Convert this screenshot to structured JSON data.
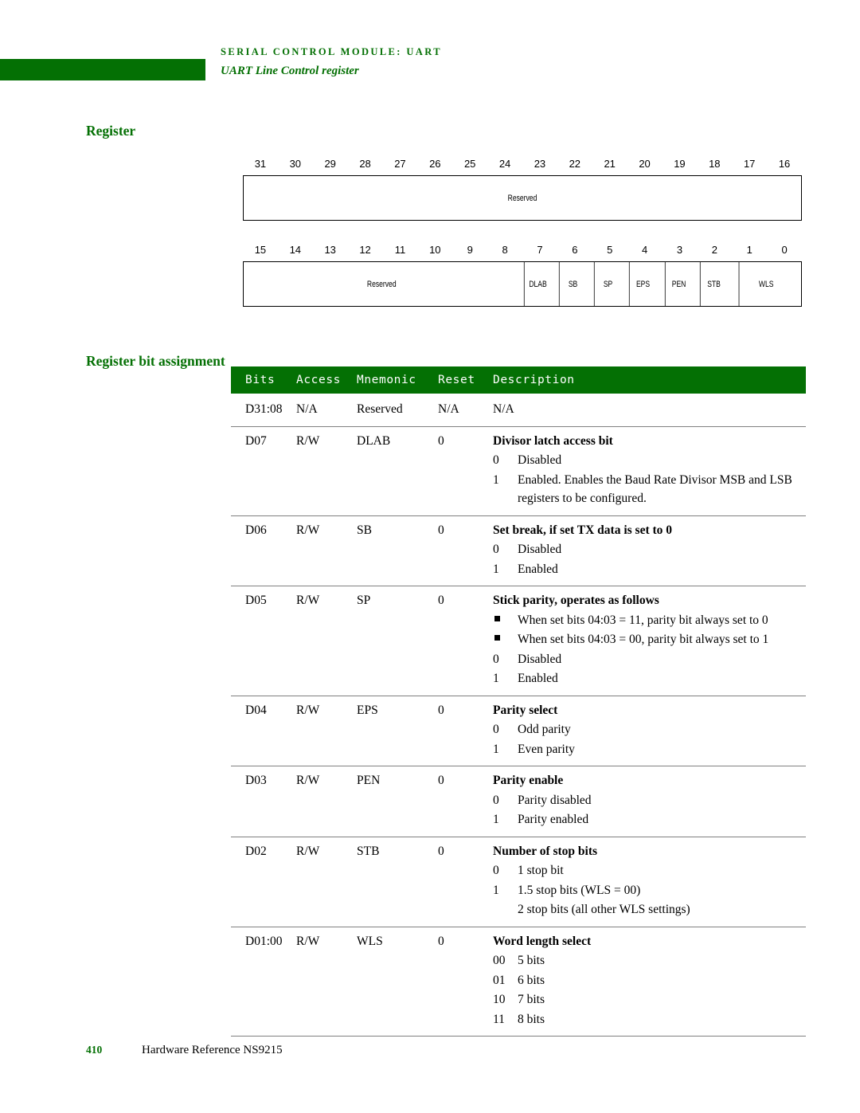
{
  "header": {
    "title": "SERIAL CONTROL MODULE: UART",
    "subtitle": "UART Line Control register",
    "bar_color": "#047004"
  },
  "margin_headings": {
    "register": "Register",
    "bit_assignment": "Register bit assignment"
  },
  "register_diagram": {
    "high_row": {
      "bit_numbers": [
        "31",
        "30",
        "29",
        "28",
        "27",
        "26",
        "25",
        "24",
        "23",
        "22",
        "21",
        "20",
        "19",
        "18",
        "17",
        "16"
      ],
      "fields": [
        {
          "label": "Reserved",
          "span": 16
        }
      ]
    },
    "low_row": {
      "bit_numbers": [
        "15",
        "14",
        "13",
        "12",
        "11",
        "10",
        "9",
        "8",
        "7",
        "6",
        "5",
        "4",
        "3",
        "2",
        "1",
        "0"
      ],
      "fields": [
        {
          "label": "Reserved",
          "span": 8
        },
        {
          "label": "DLAB",
          "span": 1
        },
        {
          "label": "SB",
          "span": 1
        },
        {
          "label": "SP",
          "span": 1
        },
        {
          "label": "EPS",
          "span": 1
        },
        {
          "label": "PEN",
          "span": 1
        },
        {
          "label": "STB",
          "span": 1
        },
        {
          "label": "WLS",
          "span": 2
        }
      ]
    }
  },
  "bit_table": {
    "columns": [
      "Bits",
      "Access",
      "Mnemonic",
      "Reset",
      "Description"
    ],
    "rows": [
      {
        "bits": "D31:08",
        "access": "N/A",
        "mnemonic": "Reserved",
        "reset": "N/A",
        "title": "N/A",
        "title_bold": false,
        "values": []
      },
      {
        "bits": "D07",
        "access": "R/W",
        "mnemonic": "DLAB",
        "reset": "0",
        "title": "Divisor latch access bit",
        "title_bold": true,
        "values": [
          {
            "key": "0",
            "text": "Disabled"
          },
          {
            "key": "1",
            "text": "Enabled. Enables the Baud Rate Divisor MSB and LSB registers to be configured."
          }
        ]
      },
      {
        "bits": "D06",
        "access": "R/W",
        "mnemonic": "SB",
        "reset": "0",
        "title": "Set break, if set TX data is set to 0",
        "title_bold": true,
        "values": [
          {
            "key": "0",
            "text": "Disabled"
          },
          {
            "key": "1",
            "text": "Enabled"
          }
        ]
      },
      {
        "bits": "D05",
        "access": "R/W",
        "mnemonic": "SP",
        "reset": "0",
        "title": "Stick parity, operates as follows",
        "title_bold": true,
        "values": [
          {
            "key": "bullet",
            "text": "When set bits 04:03 = 11, parity bit always set to 0"
          },
          {
            "key": "bullet",
            "text": "When set bits 04:03 = 00, parity bit always set to 1"
          },
          {
            "key": "0",
            "text": "Disabled"
          },
          {
            "key": "1",
            "text": "Enabled"
          }
        ]
      },
      {
        "bits": "D04",
        "access": "R/W",
        "mnemonic": "EPS",
        "reset": "0",
        "title": "Parity select",
        "title_bold": true,
        "values": [
          {
            "key": "0",
            "text": "Odd parity"
          },
          {
            "key": "1",
            "text": "Even parity"
          }
        ]
      },
      {
        "bits": "D03",
        "access": "R/W",
        "mnemonic": "PEN",
        "reset": "0",
        "title": "Parity enable",
        "title_bold": true,
        "values": [
          {
            "key": "0",
            "text": "Parity disabled"
          },
          {
            "key": "1",
            "text": "Parity enabled"
          }
        ]
      },
      {
        "bits": "D02",
        "access": "R/W",
        "mnemonic": "STB",
        "reset": "0",
        "title": "Number of stop bits",
        "title_bold": true,
        "values": [
          {
            "key": "0",
            "text": "1 stop bit"
          },
          {
            "key": "1",
            "text": "1.5 stop bits (WLS = 00)"
          },
          {
            "key": "",
            "text": "2 stop bits (all other WLS settings)"
          }
        ]
      },
      {
        "bits": "D01:00",
        "access": "R/W",
        "mnemonic": "WLS",
        "reset": "0",
        "title": "Word length select",
        "title_bold": true,
        "values": [
          {
            "key": "00",
            "text": "5 bits"
          },
          {
            "key": "01",
            "text": "6 bits"
          },
          {
            "key": "10",
            "text": "7 bits"
          },
          {
            "key": "11",
            "text": "8 bits"
          }
        ]
      }
    ]
  },
  "footer": {
    "page_number": "410",
    "document_name": "Hardware Reference NS9215"
  }
}
